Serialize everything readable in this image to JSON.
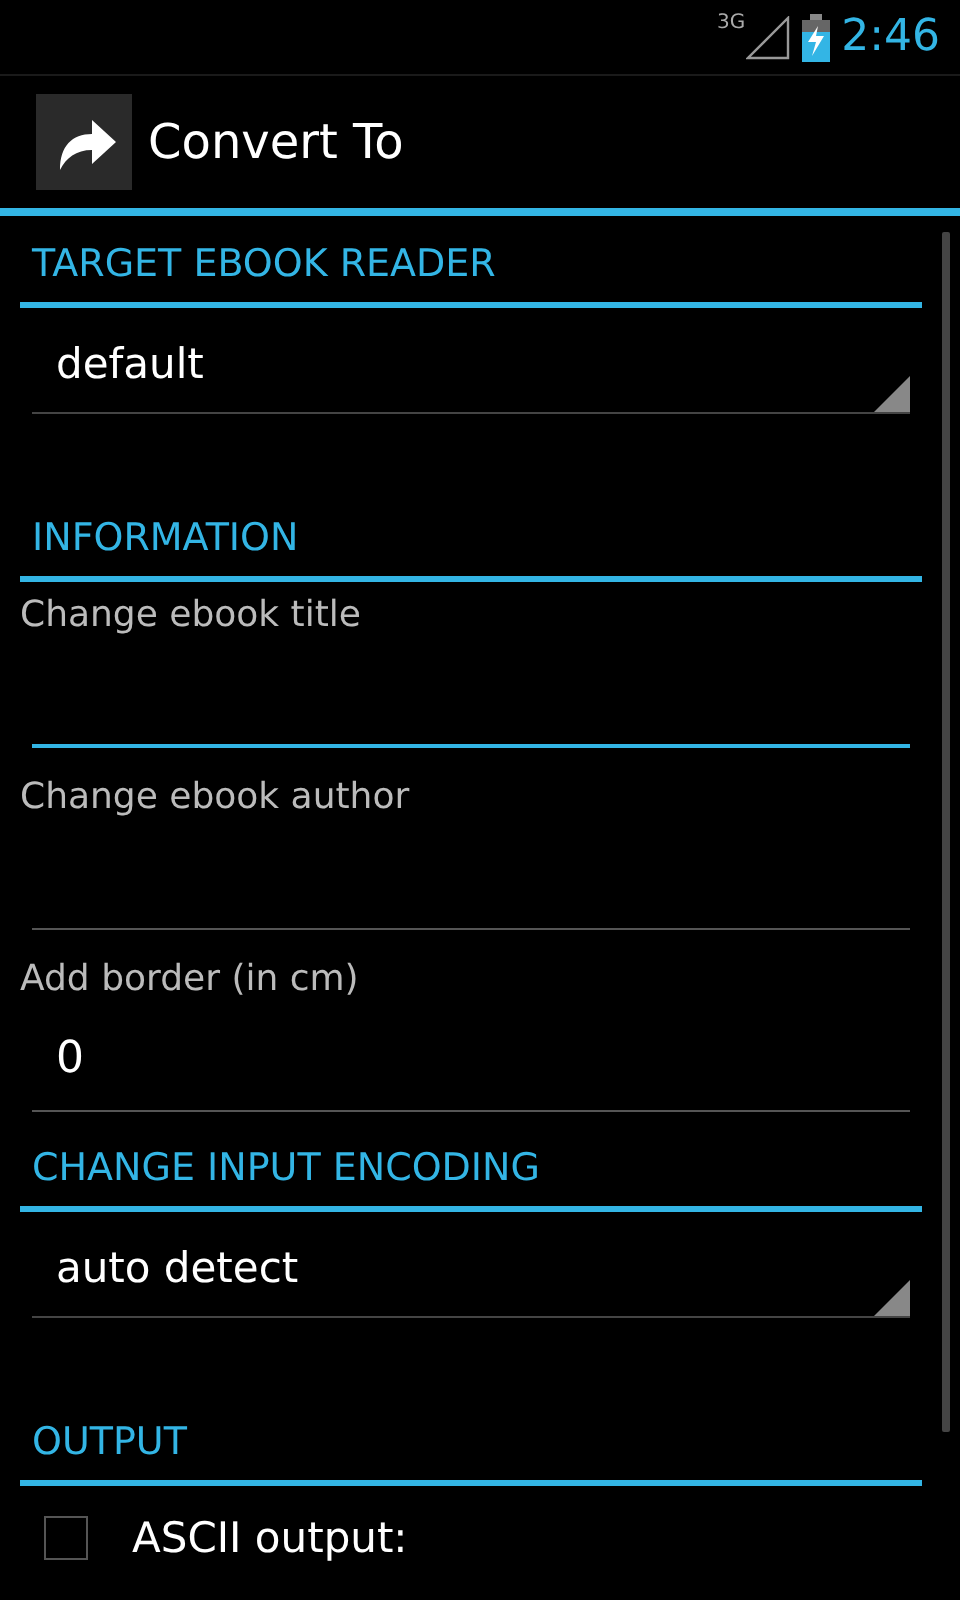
{
  "status_bar": {
    "network": "3G",
    "time": "2:46"
  },
  "action_bar": {
    "title": "Convert To"
  },
  "sections": [
    {
      "header": "TARGET EBOOK READER",
      "items": [
        {
          "kind": "spinner",
          "value": "default"
        }
      ]
    },
    {
      "header": "INFORMATION",
      "items": [
        {
          "kind": "textfield",
          "label": "Change ebook title",
          "focused": true
        },
        {
          "kind": "textfield",
          "label": "Change ebook author",
          "focused": false
        },
        {
          "kind": "textfield",
          "label": "Add border (in cm)",
          "value": "0",
          "focused": false
        }
      ]
    },
    {
      "header": "CHANGE INPUT ENCODING",
      "items": [
        {
          "kind": "spinner",
          "value": "auto detect"
        }
      ]
    },
    {
      "header": "OUTPUT",
      "items": [
        {
          "kind": "checkbox",
          "label": "ASCII output:",
          "checked": false
        }
      ]
    }
  ]
}
